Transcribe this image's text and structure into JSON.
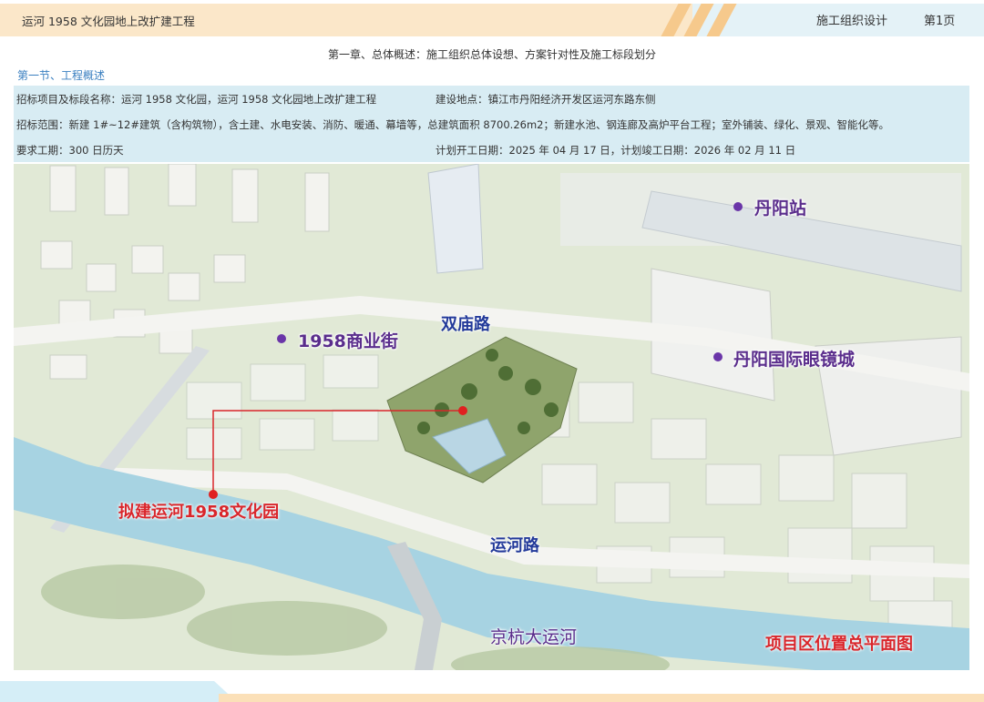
{
  "header": {
    "project_title": "运河 1958 文化园地上改扩建工程",
    "doc_type": "施工组织设计",
    "page_label": "第1页"
  },
  "chapter_title": "第一章、总体概述：施工组织总体设想、方案针对性及施工标段划分",
  "section_title": "第一节、工程概述",
  "info": {
    "bid_project": "招标项目及标段名称：运河 1958 文化园，运河 1958 文化园地上改扩建工程",
    "location": "建设地点：镇江市丹阳经济开发区运河东路东侧",
    "scope": "招标范围：新建 1#~12#建筑（含构筑物），含土建、水电安装、消防、暖通、幕墙等，总建筑面积 8700.26m2；新建水池、钢连廊及高炉平台工程；室外铺装、绿化、景观、智能化等。",
    "duration": "要求工期：300 日历天",
    "schedule": "计划开工日期：2025 年 04 月 17 日，计划竣工日期：2026 年 02 月 11 日"
  },
  "map": {
    "places": {
      "station": "丹阳站",
      "commercial_street": "1958商业街",
      "eyeglass_city": "丹阳国际眼镜城"
    },
    "roads": {
      "shuangmiao": "双庙路",
      "yunhe": "运河路",
      "grand_canal": "京杭大运河"
    },
    "project_label": "拟建运河1958文化园",
    "caption": "项目区位置总平面图",
    "colors": {
      "place_purple": "#5a2d8c",
      "road_blue": "#233a9a",
      "project_red": "#d9262b",
      "water": "#9fd0e0"
    }
  }
}
